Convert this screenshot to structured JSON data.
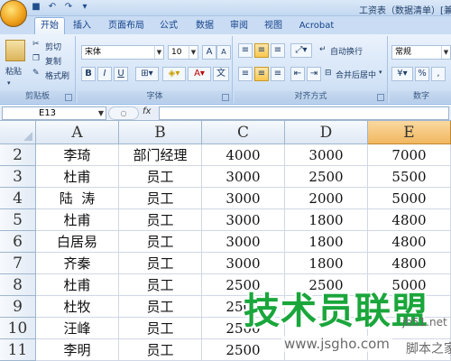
{
  "title": {
    "text": "工资表（数据清单）[兼]"
  },
  "tabs": [
    {
      "label": "开始",
      "active": true
    },
    {
      "label": "插入"
    },
    {
      "label": "页面布局"
    },
    {
      "label": "公式"
    },
    {
      "label": "数据"
    },
    {
      "label": "审阅"
    },
    {
      "label": "视图"
    },
    {
      "label": "Acrobat"
    }
  ],
  "ribbon": {
    "clipboard": {
      "label": "剪贴板",
      "paste": "粘贴",
      "cut": "剪切",
      "copy": "复制",
      "format_painter": "格式刷"
    },
    "font": {
      "label": "字体",
      "font_name": "宋体",
      "font_size": "10",
      "bold": "B",
      "italic": "I",
      "underline": "U"
    },
    "alignment": {
      "label": "对齐方式",
      "wrap_text": "自动换行",
      "merge_center": "合并后居中"
    },
    "number": {
      "label": "数字",
      "format": "常规",
      "percent": "%",
      "comma": ","
    }
  },
  "formula_bar": {
    "name_box": "E13",
    "fx": "fx",
    "formula": ""
  },
  "colors": {
    "accent": "#f1b760",
    "watermark": "#1aa63b",
    "header": "#dfe8f4"
  },
  "grid": {
    "columns": [
      "A",
      "B",
      "C",
      "D",
      "E"
    ],
    "selected_column": "E",
    "rows": [
      {
        "num": "2",
        "cells": [
          "李琦",
          "部门经理",
          "4000",
          "3000",
          "7000"
        ]
      },
      {
        "num": "3",
        "cells": [
          "杜甫",
          "员工",
          "3000",
          "2500",
          "5500"
        ]
      },
      {
        "num": "4",
        "cells": [
          "陆  涛",
          "员工",
          "3000",
          "2000",
          "5000"
        ]
      },
      {
        "num": "5",
        "cells": [
          "杜甫",
          "员工",
          "3000",
          "1800",
          "4800"
        ]
      },
      {
        "num": "6",
        "cells": [
          "白居易",
          "员工",
          "3000",
          "1800",
          "4800"
        ]
      },
      {
        "num": "7",
        "cells": [
          "齐秦",
          "员工",
          "3000",
          "1800",
          "4800"
        ]
      },
      {
        "num": "8",
        "cells": [
          "杜甫",
          "员工",
          "2500",
          "2500",
          "5000"
        ]
      },
      {
        "num": "9",
        "cells": [
          "杜牧",
          "员工",
          "2500",
          "",
          ""
        ]
      },
      {
        "num": "10",
        "cells": [
          "汪峰",
          "员工",
          "2500",
          "",
          ""
        ]
      },
      {
        "num": "11",
        "cells": [
          "李明",
          "员工",
          "2500",
          "",
          ""
        ]
      }
    ]
  },
  "watermark": {
    "text": "技术员联盟",
    "url": "www.jsgho.com",
    "side_text": "jb51.net",
    "side_text2": "脚本之家"
  }
}
